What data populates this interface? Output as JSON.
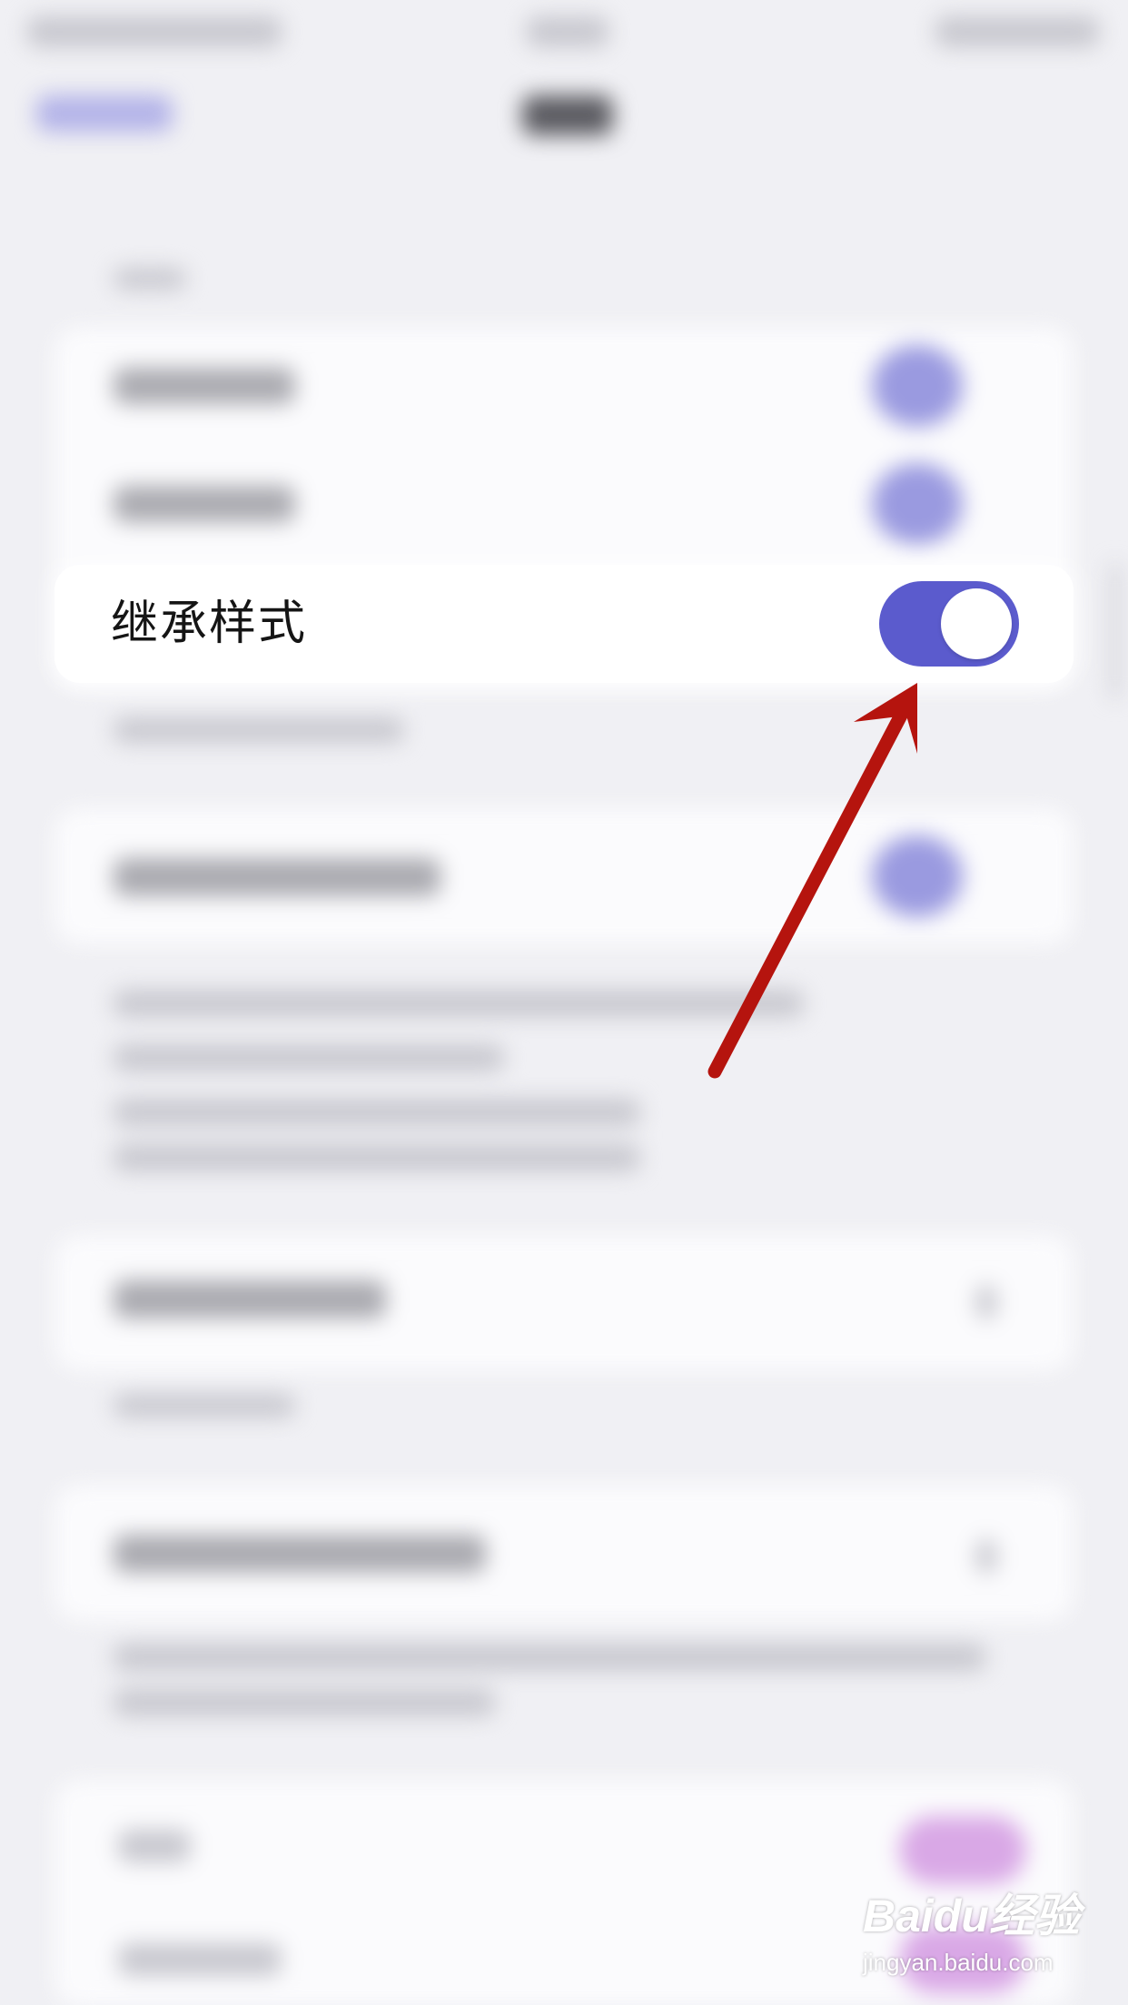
{
  "settings": {
    "inherit_style": {
      "label": "继承样式",
      "toggle_on": true,
      "accent_color": "#5b5bcd"
    }
  },
  "annotation": {
    "arrow_color": "#b5140e",
    "arrow_target": "toggle"
  },
  "watermark": {
    "logo": "Baidu经验",
    "url": "jingyan.baidu.com"
  },
  "colors": {
    "background": "#f0f0f4",
    "card": "#ffffff"
  }
}
